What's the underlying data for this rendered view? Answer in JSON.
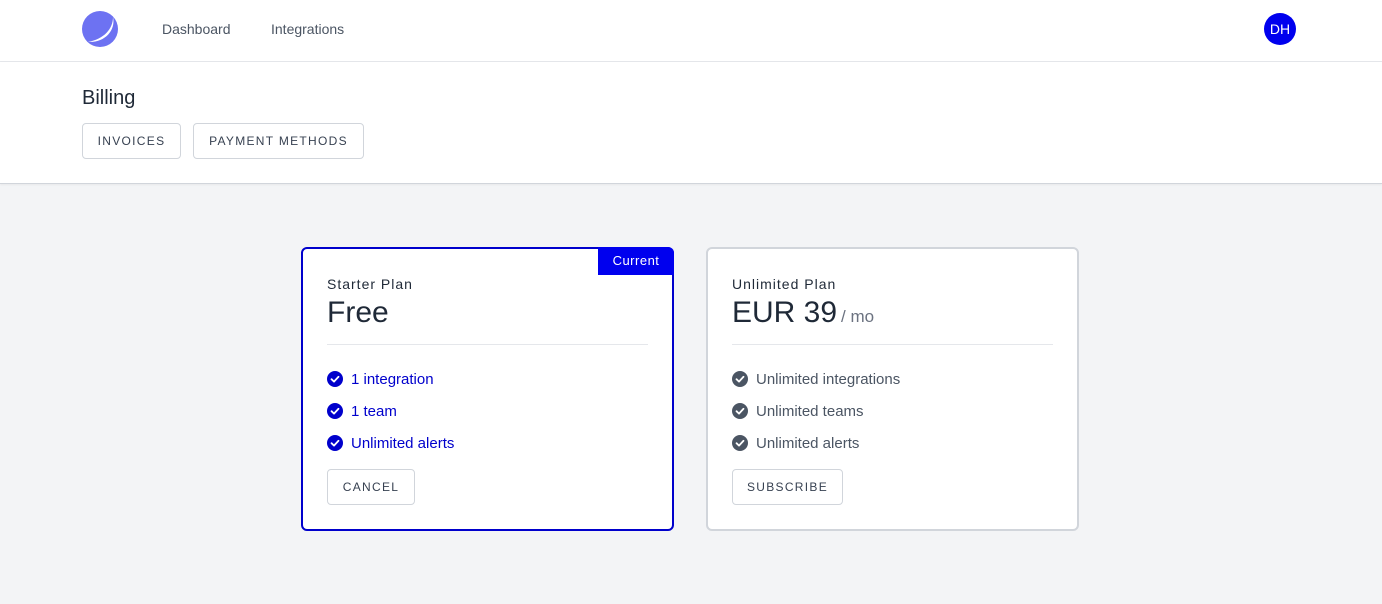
{
  "nav": {
    "logo_icon": "crescent-logo-icon",
    "links": [
      "Dashboard",
      "Integrations"
    ],
    "avatar_initials": "DH",
    "avatar_color": "#0000ee"
  },
  "header": {
    "title": "Billing",
    "buttons": [
      "INVOICES",
      "PAYMENT METHODS"
    ]
  },
  "plans": [
    {
      "name": "Starter Plan",
      "price": "Free",
      "period": "",
      "badge": "Current",
      "features": [
        "1 integration",
        "1 team",
        "Unlimited alerts"
      ],
      "button": "CANCEL",
      "accent": "#0000cc"
    },
    {
      "name": "Unlimited Plan",
      "price": "EUR 39",
      "period": "/ mo",
      "badge": "",
      "features": [
        "Unlimited integrations",
        "Unlimited teams",
        "Unlimited alerts"
      ],
      "button": "SUBSCRIBE",
      "accent": "#4b5563"
    }
  ],
  "icons": {
    "check": "check-circle-icon"
  }
}
